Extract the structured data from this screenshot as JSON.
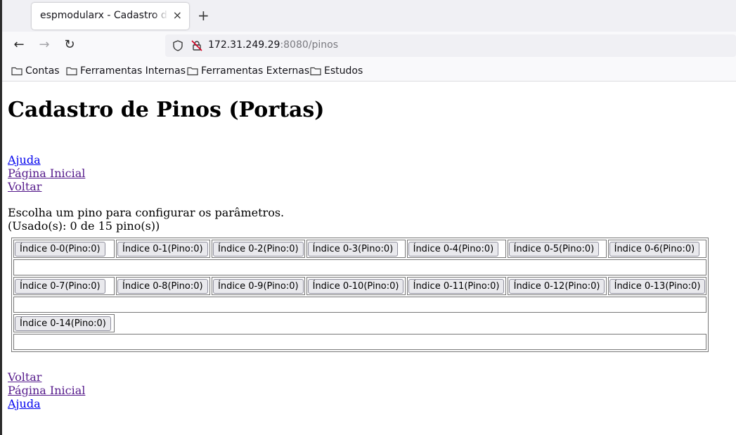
{
  "browser": {
    "tab_title": "espmodularx - Cadastro do Módulo",
    "tab_close": "×",
    "new_tab": "+",
    "url_host": "172.31.249.29",
    "url_rest": ":8080/pinos",
    "back": "←",
    "forward": "→",
    "reload": "↻",
    "bookmarks": [
      "Contas",
      "Ferramentas Internas",
      "Ferramentas Externas",
      "Estudos"
    ]
  },
  "page": {
    "title": "Cadastro de Pinos (Portas)",
    "top_links": [
      "Ajuda",
      "Página Inicial",
      "Voltar"
    ],
    "instruction": "Escolha um pino para configurar os parâmetros.",
    "usage": "(Usado(s): 0 de 15 pino(s))",
    "pins": [
      "Índice 0-0(Pino:0)",
      "Índice 0-1(Pino:0)",
      "Índice 0-2(Pino:0)",
      "Índice 0-3(Pino:0)",
      "Índice 0-4(Pino:0)",
      "Índice 0-5(Pino:0)",
      "Índice 0-6(Pino:0)",
      "Índice 0-7(Pino:0)",
      "Índice 0-8(Pino:0)",
      "Índice 0-9(Pino:0)",
      "Índice 0-10(Pino:0)",
      "Índice 0-11(Pino:0)",
      "Índice 0-12(Pino:0)",
      "Índice 0-13(Pino:0)",
      "Índice 0-14(Pino:0)"
    ],
    "bottom_links": [
      "Voltar",
      "Página Inicial",
      "Ajuda"
    ]
  }
}
